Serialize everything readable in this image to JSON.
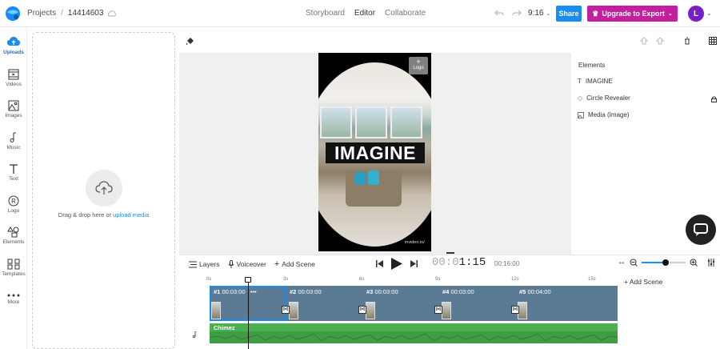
{
  "header": {
    "breadcrumb_root": "Projects",
    "project_id": "14414603",
    "tabs": [
      {
        "label": "Storyboard",
        "active": false
      },
      {
        "label": "Editor",
        "active": true
      },
      {
        "label": "Collaborate",
        "active": false
      }
    ],
    "aspect_ratio": "9:16",
    "share_label": "Share",
    "upgrade_label": "Upgrade to Export",
    "avatar_initial": "L"
  },
  "sidebar": {
    "items": [
      {
        "label": "Uploads",
        "icon": "upload-cloud-icon",
        "active": true
      },
      {
        "label": "Videos",
        "icon": "video-icon"
      },
      {
        "label": "Images",
        "icon": "image-icon"
      },
      {
        "label": "Music",
        "icon": "music-icon"
      },
      {
        "label": "Text",
        "icon": "text-icon"
      },
      {
        "label": "Logo",
        "icon": "logo-icon"
      },
      {
        "label": "Elements",
        "icon": "elements-icon"
      },
      {
        "label": "Templates",
        "icon": "templates-icon"
      },
      {
        "label": "More",
        "icon": "more-icon"
      }
    ]
  },
  "upload": {
    "drag_text": "Drag & drop here or ",
    "link_text": "upload media"
  },
  "canvas": {
    "headline": "IMAGINE",
    "logo_placeholder": "Logo",
    "watermark": "invideo.io/"
  },
  "elements_panel": {
    "title": "Elements",
    "items": [
      {
        "label": "IMAGINE",
        "icon": "text-icon"
      },
      {
        "label": "Circle Revealer",
        "icon": "diamond-icon"
      },
      {
        "label": "Media (Image)",
        "icon": "image-icon"
      }
    ]
  },
  "timeline": {
    "layers_label": "Layers",
    "voiceover_label": "Voiceover",
    "add_scene_label": "Add Scene",
    "current_time_dim": "00:0",
    "current_time_strong": "1:15",
    "total_time": "00:16:00",
    "ruler": [
      "0s",
      "3s",
      "6s",
      "9s",
      "12s",
      "15s"
    ],
    "add_scene_right": "Add Scene",
    "scenes": [
      {
        "label": "#1",
        "time": "00:03:00",
        "selected": true
      },
      {
        "label": "#2",
        "time": "00:03:00"
      },
      {
        "label": "#3",
        "time": "00:03:00"
      },
      {
        "label": "#4",
        "time": "00:03:00"
      },
      {
        "label": "#5",
        "time": "00:04:00"
      }
    ],
    "audio_label": "Chimez"
  },
  "colors": {
    "share": "#1a8cf0",
    "upgrade": "#c3209f",
    "avatar": "#7a1fc7",
    "scene_track": "#5b7a93",
    "audio_track": "#4caf50"
  }
}
